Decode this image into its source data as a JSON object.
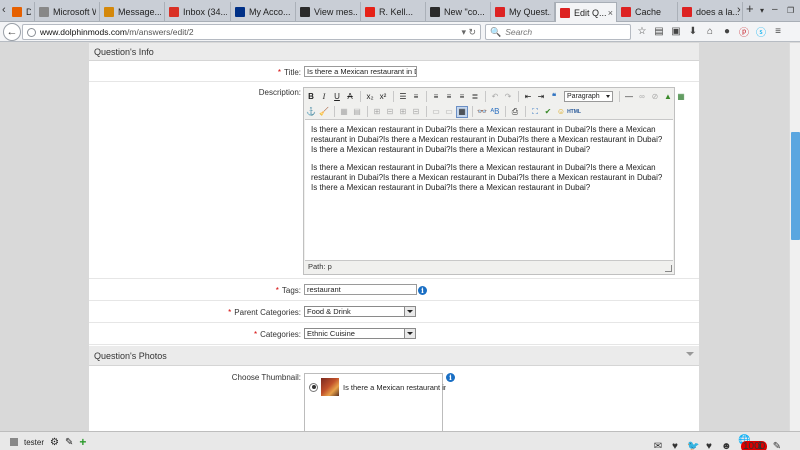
{
  "tabs": [
    {
      "label": "D...",
      "icon": "firefox-icon",
      "color": "#e66000"
    },
    {
      "label": "Microsoft Wo...",
      "icon": "page-icon",
      "color": "#888888"
    },
    {
      "label": "Message...",
      "icon": "forum-icon",
      "color": "#d4880a"
    },
    {
      "label": "Inbox (34...",
      "icon": "gmail-icon",
      "color": "#d93025"
    },
    {
      "label": "My Acco...",
      "icon": "paypal-icon",
      "color": "#003087"
    },
    {
      "label": "View mes...",
      "icon": "cc-icon",
      "color": "#2b2b2b"
    },
    {
      "label": "R. Kell...",
      "icon": "youtube-icon",
      "color": "#e62117"
    },
    {
      "label": "New \"co...",
      "icon": "cc-icon",
      "color": "#2b2b2b"
    },
    {
      "label": "My Quest...",
      "icon": "dolphin-icon",
      "color": "#d22"
    },
    {
      "label": "Edit Q...",
      "icon": "dolphin-icon",
      "color": "#d22"
    },
    {
      "label": "Cache",
      "icon": "dolphin-icon",
      "color": "#d22"
    },
    {
      "label": "does a la...",
      "icon": "dolphin-icon",
      "color": "#d22"
    }
  ],
  "nav": {
    "url_domain": "www.dolphinmods.com",
    "url_path": "/m/answers/edit/2",
    "search_placeholder": "Search"
  },
  "form": {
    "section_info": "Question's Info",
    "title_label": "Title:",
    "title_value": "Is there a Mexican restaurant in Dubai",
    "description_label": "Description:",
    "paragraph_format": "Paragraph",
    "description_paragraphs": [
      "Is there a Mexican restaurant in Dubai?Is there a Mexican restaurant in Dubai?Is there a Mexican restaurant in Dubai?Is there a Mexican restaurant in Dubai?Is there a Mexican restaurant in Dubai?Is there a Mexican restaurant in Dubai?Is there a Mexican restaurant in Dubai?",
      "Is there a Mexican restaurant in Dubai?Is there a Mexican restaurant in Dubai?Is there a Mexican restaurant in Dubai?Is there a Mexican restaurant in Dubai?Is there a Mexican restaurant in Dubai?Is there a Mexican restaurant in Dubai?Is there a Mexican restaurant in Dubai?"
    ],
    "path_text": "Path: p",
    "tags_label": "Tags:",
    "tags_value": "restaurant",
    "parent_categories_label": "Parent Categories:",
    "parent_category_value": "Food & Drink",
    "categories_label": "Categories:",
    "category_value": "Ethnic Cuisine",
    "section_photos": "Question's Photos",
    "thumbnail_label": "Choose Thumbnail:",
    "thumbnail_text": "Is there a Mexican restaurant in Dubai"
  },
  "bottom": {
    "user": "tester",
    "notifications": "1000"
  }
}
